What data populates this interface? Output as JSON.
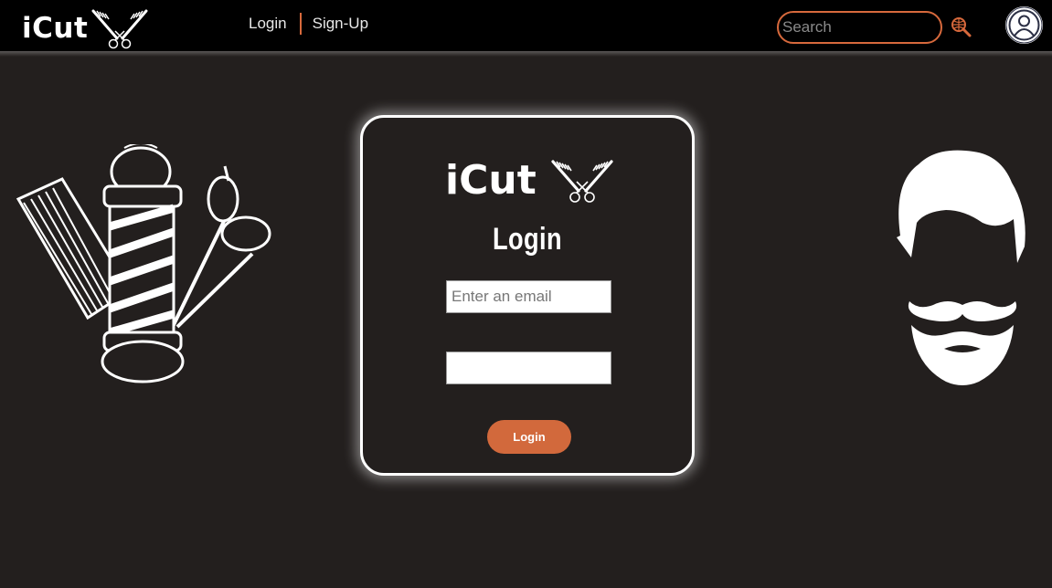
{
  "navbar": {
    "brand": "iCut",
    "links": [
      {
        "label": "Login"
      },
      {
        "label": "Sign-Up"
      }
    ],
    "search": {
      "placeholder": "Search",
      "value": ""
    }
  },
  "card": {
    "brand": "iCut",
    "title": "Login",
    "email_placeholder": "Enter an email",
    "password_placeholder": "",
    "button_label": "Login"
  },
  "icons": {
    "brand": "scissors-comb-icon",
    "search": "search-globe-icon",
    "avatar": "user-avatar-icon",
    "left_illustration": "barber-pole-comb-scissors-illustration",
    "right_illustration": "hair-beard-moustache-illustration"
  },
  "colors": {
    "background": "#231f1e",
    "navbar": "#000000",
    "accent": "#d7693c",
    "button": "#d2693c",
    "text": "#ffffff"
  }
}
